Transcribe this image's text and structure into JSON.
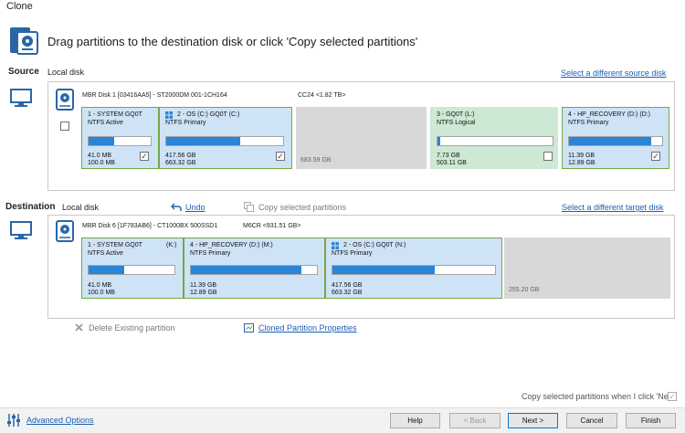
{
  "window": {
    "title": "Clone"
  },
  "header": {
    "instruction": "Drag partitions to the destination disk or click 'Copy selected partitions'"
  },
  "source": {
    "label": "Source",
    "disk_type": "Local disk",
    "select_link": "Select a different source disk",
    "disk_info": "MBR Disk 1 [03416AA5] - ST2000DM 001-1CH164",
    "disk_info2": "CC24  <1.82 TB>",
    "partitions": [
      {
        "name": "1 - SYSTEM   GQ0T",
        "type": "NTFS Active",
        "used": "41.0 MB",
        "total": "100.0 MB",
        "fill": 0.41,
        "checked": true
      },
      {
        "name": "2 - OS (C:) GQ0T   (C:)",
        "type": "NTFS Primary",
        "used": "417.56 GB",
        "total": "663.32 GB",
        "fill": 0.63,
        "checked": true
      },
      {
        "unalloc": "683.59 GB"
      },
      {
        "name": "3 - GQ0T (L:)",
        "type": "NTFS Logical",
        "used": "7.73 GB",
        "total": "503.11 GB",
        "fill": 0.02,
        "checked": false
      },
      {
        "name": "4 - HP_RECOVERY (D:) (D:)",
        "type": "NTFS Primary",
        "used": "11.39 GB",
        "total": "12.89 GB",
        "fill": 0.88,
        "checked": true
      }
    ]
  },
  "destination": {
    "label": "Destination",
    "disk_type": "Local disk",
    "undo": "Undo",
    "copy": "Copy selected partitions",
    "select_link": "Select a different target disk",
    "disk_info": "MBR Disk 6 [1F783AB6] - CT1000BX 500SSD1",
    "disk_info2": "M6CR   <931.51 GB>",
    "partitions": [
      {
        "name": "1 - SYSTEM   GQ0T",
        "letter": "(K:)",
        "type": "NTFS Active",
        "used": "41.0 MB",
        "total": "100.0 MB",
        "fill": 0.41
      },
      {
        "name": "4 - HP_RECOVERY (D:) (M:)",
        "type": "NTFS Primary",
        "used": "11.39 GB",
        "total": "12.89 GB",
        "fill": 0.88
      },
      {
        "name": "2 - OS (C:) GQ0T   (N:)",
        "type": "NTFS Primary",
        "used": "417.56 GB",
        "total": "663.32 GB",
        "fill": 0.63
      },
      {
        "unalloc": "255.20 GB"
      }
    ],
    "delete": "Delete Existing partition",
    "props": "Cloned Partition Properties"
  },
  "footer": {
    "copy_check": "Copy selected partitions when I click 'Next'",
    "advanced": "Advanced Options",
    "help": "Help",
    "back": "< Back",
    "next": "Next >",
    "cancel": "Cancel",
    "finish": "Finish"
  }
}
